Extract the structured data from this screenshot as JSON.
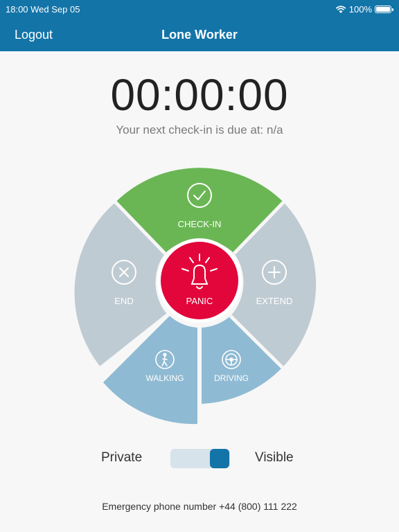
{
  "status_bar": {
    "time_date": "18:00 Wed Sep 05",
    "battery": "100%"
  },
  "nav": {
    "left_button": "Logout",
    "title": "Lone Worker"
  },
  "timer": {
    "value": "00:00:00",
    "next_checkin": "Your next check-in is due at: n/a"
  },
  "wheel": {
    "checkin": {
      "label": "CHECK-IN",
      "icon": "check-icon",
      "color": "#6ab654"
    },
    "end": {
      "label": "END",
      "icon": "close-icon",
      "color": "#bfcbd2"
    },
    "extend": {
      "label": "EXTEND",
      "icon": "plus-icon",
      "color": "#bfcbd2"
    },
    "walking": {
      "label": "WALKING",
      "icon": "walking-person-icon",
      "color": "#8fbad3"
    },
    "driving": {
      "label": "DRIVING",
      "icon": "steering-wheel-icon",
      "color": "#8fbad3"
    },
    "panic": {
      "label": "PANIC",
      "icon": "alarm-bell-icon",
      "color": "#e3063b"
    }
  },
  "visibility": {
    "left_label": "Private",
    "right_label": "Visible",
    "state": "Visible"
  },
  "emergency_text": "Emergency phone number +44 (800) 111 222"
}
